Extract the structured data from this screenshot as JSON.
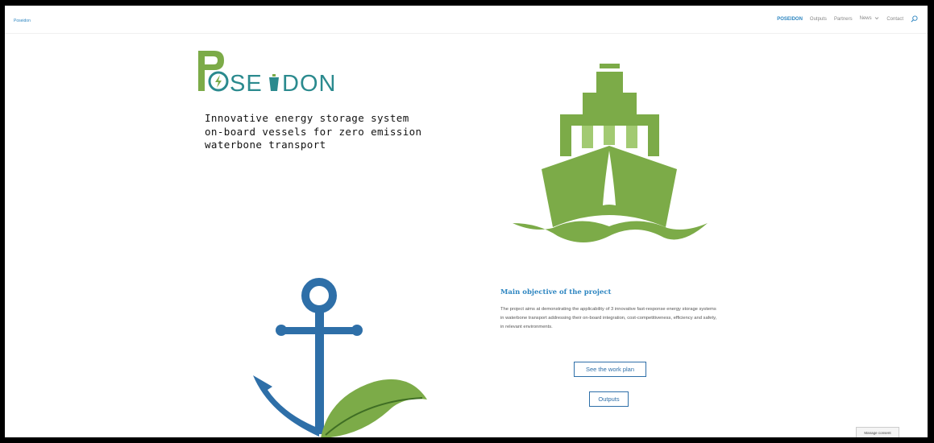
{
  "site": {
    "title": "Poseidon"
  },
  "nav": {
    "items": [
      {
        "label": "POSEIDON",
        "active": true
      },
      {
        "label": "Outputs",
        "active": false
      },
      {
        "label": "Partners",
        "active": false
      },
      {
        "label": "News",
        "active": false,
        "dropdown": true
      },
      {
        "label": "Contact",
        "active": false
      }
    ],
    "search_icon": "search-icon"
  },
  "hero": {
    "logo_text": "POSEIDON",
    "tagline": [
      "Innovative energy storage system",
      "on-board vessels for zero emission",
      "waterbone transport"
    ]
  },
  "objective": {
    "title": "Main objective of the project",
    "text": "The project aims at demonstrating the applicability of 3 innovative fast-response energy storage systems in waterbone transport addressing their on-board integration, cost-competitiveness, efficiency and safety, in relevant environments."
  },
  "buttons": {
    "work_plan": "See the work plan",
    "outputs": "Outputs"
  },
  "consent": {
    "label": "Manage consent"
  },
  "colors": {
    "green_dark": "#7cab48",
    "green_light": "#a2ca72",
    "blue": "#2e6fa8",
    "teal": "#2b8a8e",
    "link_blue": "#2e86c1"
  },
  "icons": [
    "ship-illustration",
    "anchor-illustration",
    "leaf-illustration",
    "lightning-icon",
    "chevron-down-icon",
    "search-icon"
  ]
}
